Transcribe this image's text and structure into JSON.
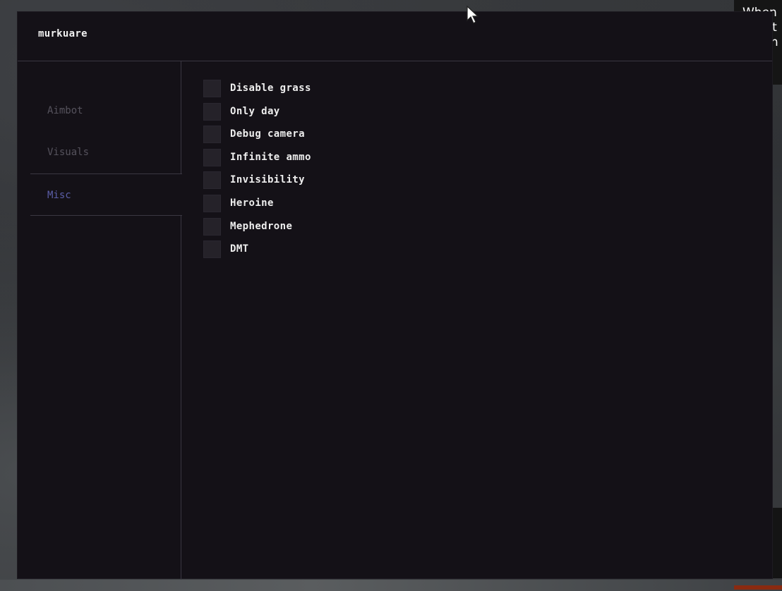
{
  "menu": {
    "title": "murkuare"
  },
  "sidebar": {
    "tabs": [
      {
        "label": "Aimbot",
        "active": false
      },
      {
        "label": "Visuals",
        "active": false
      },
      {
        "label": "Misc",
        "active": true
      }
    ]
  },
  "misc": {
    "options": [
      {
        "label": "Disable grass",
        "checked": false
      },
      {
        "label": "Only day",
        "checked": false
      },
      {
        "label": "Debug camera",
        "checked": false
      },
      {
        "label": "Infinite ammo",
        "checked": false
      },
      {
        "label": "Invisibility",
        "checked": false
      },
      {
        "label": "Heroine",
        "checked": false
      },
      {
        "label": "Mephedrone",
        "checked": false
      },
      {
        "label": "DMT",
        "checked": false
      }
    ]
  },
  "tooltip": {
    "lines": [
      "When",
      "sure t",
      "else h"
    ]
  },
  "colors": {
    "window_bg": "#141117",
    "border": "#3a3742",
    "active_tab": "#5b5ea8",
    "inactive_tab": "#55525c",
    "checkbox_bg": "#252229",
    "label_text": "#eeeeee"
  },
  "icons": {
    "cursor": "mouse-pointer-icon"
  }
}
